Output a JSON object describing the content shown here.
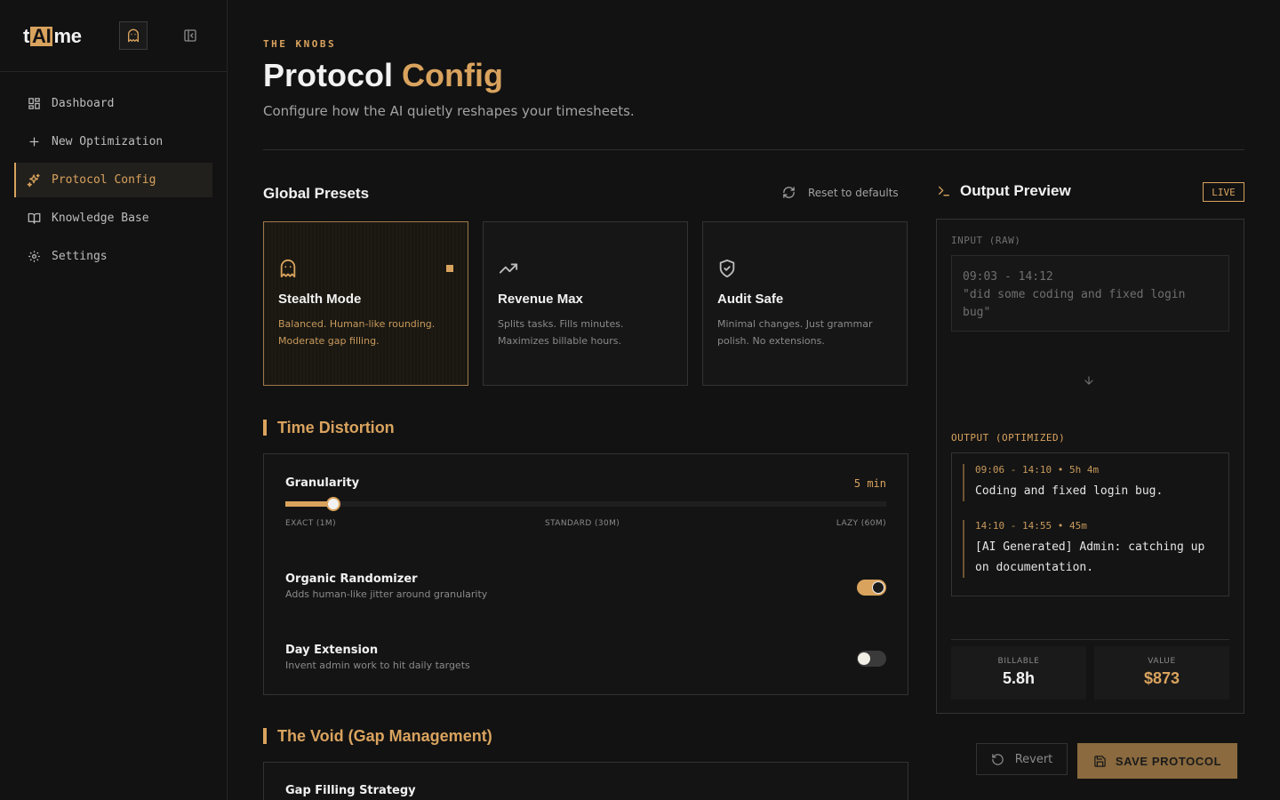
{
  "brand": {
    "logo_prefix": "t",
    "logo_ai": "AI",
    "logo_suffix": "me"
  },
  "sidebar": {
    "items": [
      {
        "label": "Dashboard",
        "icon": "dashboard-icon",
        "active": false
      },
      {
        "label": "New Optimization",
        "icon": "plus-icon",
        "active": false
      },
      {
        "label": "Protocol Config",
        "icon": "sparkles-icon",
        "active": true
      },
      {
        "label": "Knowledge Base",
        "icon": "book-icon",
        "active": false
      },
      {
        "label": "Settings",
        "icon": "gear-icon",
        "active": false
      }
    ]
  },
  "header": {
    "eyebrow": "THE KNOBS",
    "title_main": "Protocol",
    "title_accent": "Config",
    "subtitle": "Configure how the AI quietly reshapes your timesheets."
  },
  "presets": {
    "heading": "Global Presets",
    "reset_label": "Reset to defaults",
    "items": [
      {
        "name": "Stealth Mode",
        "desc": "Balanced. Human-like rounding. Moderate gap filling.",
        "icon": "ghost-icon",
        "selected": true
      },
      {
        "name": "Revenue Max",
        "desc": "Splits tasks. Fills minutes. Maximizes billable hours.",
        "icon": "trending-up-icon",
        "selected": false
      },
      {
        "name": "Audit Safe",
        "desc": "Minimal changes. Just grammar polish. No extensions.",
        "icon": "shield-check-icon",
        "selected": false
      }
    ]
  },
  "time_distortion": {
    "heading": "Time Distortion",
    "granularity": {
      "label": "Granularity",
      "value": "5 min",
      "level": 0.08,
      "ticks": [
        "EXACT (1M)",
        "STANDARD (30M)",
        "LAZY (60M)"
      ]
    },
    "randomizer": {
      "title": "Organic Randomizer",
      "desc": "Adds human-like jitter around granularity",
      "on": true
    },
    "day_extension": {
      "title": "Day Extension",
      "desc": "Invent admin work to hit daily targets",
      "on": false
    }
  },
  "void": {
    "heading": "The Void (Gap Management)",
    "strategy_label": "Gap Filling Strategy"
  },
  "output_preview": {
    "title": "Output Preview",
    "badge": "LIVE",
    "input_label": "INPUT (RAW)",
    "input_line1": "09:03 - 14:12",
    "input_line2": "\"did some coding and fixed login bug\"",
    "output_label": "OUTPUT (OPTIMIZED)",
    "entries": [
      {
        "meta": "09:06 - 14:10 • 5h 4m",
        "text": "Coding and fixed login bug."
      },
      {
        "meta": "14:10 - 14:55 • 45m",
        "text": "[AI Generated] Admin: catching up on documentation."
      }
    ],
    "stats": [
      {
        "label": "BILLABLE",
        "value": "5.8h"
      },
      {
        "label": "VALUE",
        "value": "$873"
      }
    ]
  },
  "actions": {
    "revert": "Revert",
    "save": "SAVE PROTOCOL"
  },
  "colors": {
    "accent": "#d9a35e",
    "background": "#121212",
    "panel": "#141414",
    "border": "#333333"
  }
}
